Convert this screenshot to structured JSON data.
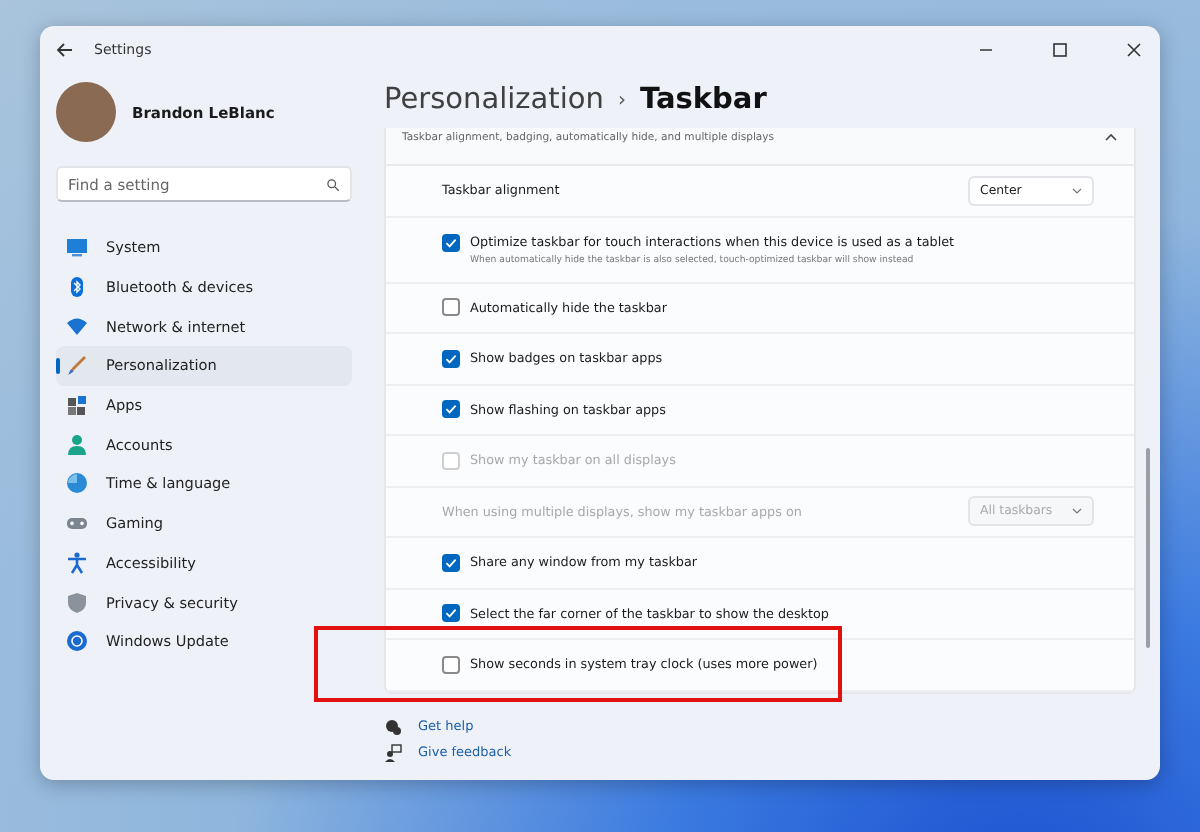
{
  "window": {
    "title": "Settings"
  },
  "profile": {
    "name": "Brandon LeBlanc"
  },
  "search": {
    "placeholder": "Find a setting"
  },
  "nav": [
    {
      "label": "System",
      "kind": "system",
      "selected": false
    },
    {
      "label": "Bluetooth & devices",
      "kind": "bluetooth",
      "selected": false
    },
    {
      "label": "Network & internet",
      "kind": "network",
      "selected": false
    },
    {
      "label": "Personalization",
      "kind": "brush",
      "selected": true
    },
    {
      "label": "Apps",
      "kind": "apps",
      "selected": false
    },
    {
      "label": "Accounts",
      "kind": "accounts",
      "selected": false
    },
    {
      "label": "Time & language",
      "kind": "time",
      "selected": false
    },
    {
      "label": "Gaming",
      "kind": "gaming",
      "selected": false
    },
    {
      "label": "Accessibility",
      "kind": "accessibility",
      "selected": false
    },
    {
      "label": "Privacy & security",
      "kind": "privacy",
      "selected": false
    },
    {
      "label": "Windows Update",
      "kind": "update",
      "selected": false
    }
  ],
  "breadcrumb": {
    "parent": "Personalization",
    "separator": "›",
    "current": "Taskbar"
  },
  "section": {
    "subtitle": "Taskbar alignment, badging, automatically hide, and multiple displays",
    "expanded": true
  },
  "rows": [
    {
      "kind": "dropdown",
      "label": "Taskbar alignment",
      "value": "Center",
      "disabled": false
    },
    {
      "kind": "checkbox",
      "label": "Optimize taskbar for touch interactions when this device is used as a tablet",
      "description": "When automatically hide the taskbar is also selected, touch-optimized taskbar will show instead",
      "checked": true,
      "disabled": false
    },
    {
      "kind": "checkbox",
      "label": "Automatically hide the taskbar",
      "checked": false,
      "disabled": false
    },
    {
      "kind": "checkbox",
      "label": "Show badges on taskbar apps",
      "checked": true,
      "disabled": false
    },
    {
      "kind": "checkbox",
      "label": "Show flashing on taskbar apps",
      "checked": true,
      "disabled": false
    },
    {
      "kind": "checkbox",
      "label": "Show my taskbar on all displays",
      "checked": false,
      "disabled": true
    },
    {
      "kind": "dropdown",
      "label": "When using multiple displays, show my taskbar apps on",
      "value": "All taskbars",
      "disabled": true
    },
    {
      "kind": "checkbox",
      "label": "Share any window from my taskbar",
      "checked": true,
      "disabled": false
    },
    {
      "kind": "checkbox",
      "label": "Select the far corner of the taskbar to show the desktop",
      "checked": true,
      "disabled": false
    },
    {
      "kind": "checkbox",
      "label": "Show seconds in system tray clock (uses more power)",
      "checked": false,
      "disabled": false,
      "highlighted": true
    }
  ],
  "links": [
    {
      "label": "Get help",
      "kind": "help"
    },
    {
      "label": "Give feedback",
      "kind": "feedback"
    }
  ]
}
